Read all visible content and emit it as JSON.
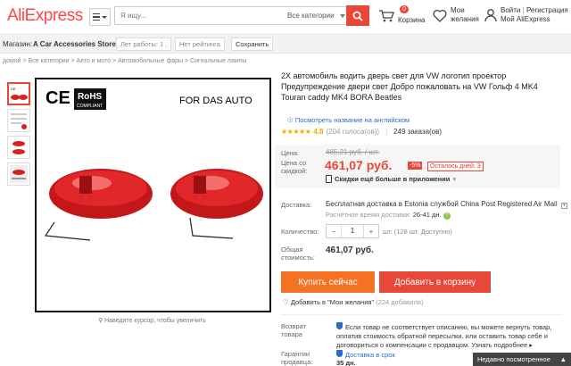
{
  "header": {
    "logo": "AliExpress",
    "search_placeholder": "Я ищу...",
    "category": "Все категории",
    "cart_count": "0",
    "cart_label": "Корзина",
    "wish_label_1": "Мои",
    "wish_label_2": "желания",
    "login": "Войти",
    "register": "Регистрация",
    "my_ali": "Мой AliExpress"
  },
  "store": {
    "label": "Магазин:",
    "name": "A Car Accessories Store",
    "years": "Лет работы: 1 .",
    "rating": "Нет рейтинга",
    "save": "Сохранить"
  },
  "breadcrumb": "домой > Все категории > Авто и мото > Автомобильные фары > Сигнальные лампы",
  "image": {
    "brand_text": "FOR  DAS AUTO",
    "ce": "CE",
    "rohs": "RoHS",
    "rohs_sub": "COMPLIANT",
    "zoom_hint": "Наведите курсор, чтобы увеличить"
  },
  "product": {
    "title": "2X автомобиль водить дверь свет для VW логотип проектор Предупреждение двери свет Добро пожаловать на VW Гольф 4 MK4 Touran caddy MK4 BORA Beatles",
    "translate_link": "Посмотреть название на английском",
    "rating": "4.8",
    "votes": "(204 голоса(ов))",
    "orders": "249 заказа(ов)",
    "price_label": "Цена:",
    "old_price": "485,21 руб. / шт.",
    "discount_label": "Цена со скидкой:",
    "new_price": "461,07 руб.",
    "discount": "-5%",
    "days_left": "Осталось дней: 3",
    "app_discount": "Скидки ещё больше в приложении",
    "delivery_label": "Доставка:",
    "delivery": "Бесплатная доставка в Estonia службой China Post Registered Air Mail",
    "eta_label": "Расчётное время доставки:",
    "eta": "26-41 дн.",
    "qty_label": "Количество:",
    "qty": "1",
    "qty_unit": "шт. (128 шт. Доступно)",
    "total_label": "Общая стоимость:",
    "total": "461,07 руб.",
    "buy_now": "Купить сейчас",
    "add_to_cart": "Добавить в корзину",
    "wishlist": "Добавить в \"Мои желания\"",
    "wishlist_count": "(224 добавили)",
    "return_label": "Возврат товара",
    "return_text": "Если товар не соответствует описанию, вы можете вернуть товар, оплатив стоимость обратной пересылки, или оставить товар себе и договориться о компенсации с продавцом.",
    "return_more": "Узнать подробнее",
    "guarantee_label": "Гарантии продавца:",
    "guarantee_title": "Доставка в срок",
    "guarantee_days": "35 дн."
  },
  "recent": "Недавно посмотренное",
  "colors": {
    "accent": "#e8483a",
    "buy": "#f57224",
    "link": "#2a6acb",
    "star": "#f7a700"
  }
}
